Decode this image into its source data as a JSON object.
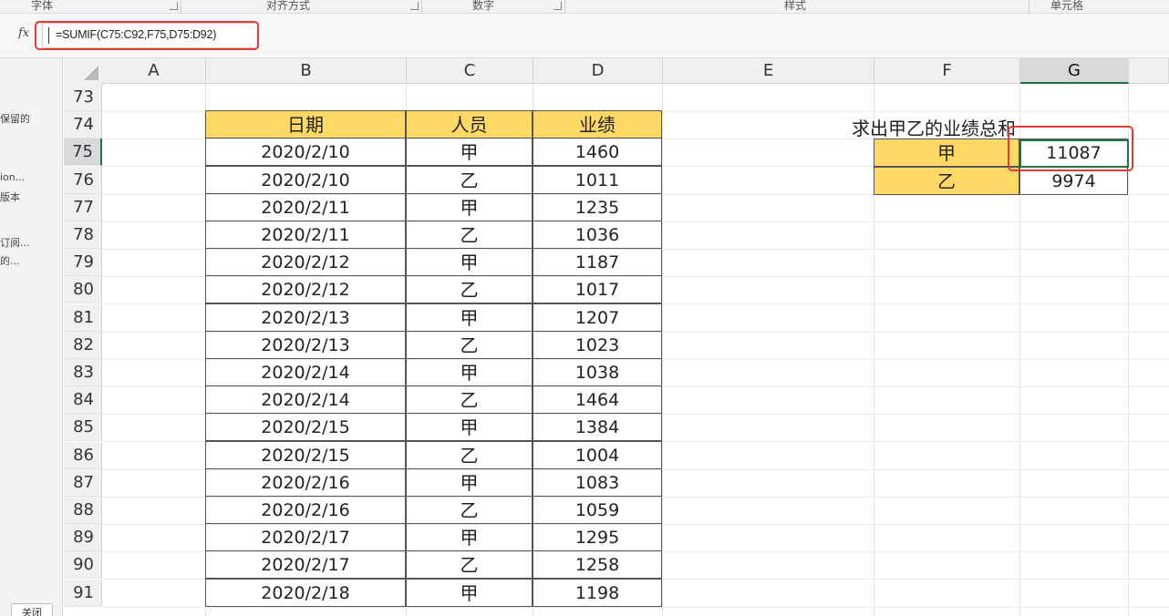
{
  "ribbon_groups": [
    "字体",
    "对齐方式",
    "数字",
    "样式",
    "单元格"
  ],
  "formula_bar": {
    "fx_label": "fx",
    "formula": "=SUMIF(C75:C92,F75,D75:D92)"
  },
  "side_panel": {
    "items": [
      "保留的",
      "ion...",
      "版本",
      "订阅...",
      "的..."
    ],
    "close_label": "关闭"
  },
  "columns": [
    "A",
    "B",
    "C",
    "D",
    "E",
    "F",
    "G"
  ],
  "active_column": "G",
  "row_numbers": [
    "73",
    "74",
    "75",
    "76",
    "77",
    "78",
    "79",
    "80",
    "81",
    "82",
    "83",
    "84",
    "85",
    "86",
    "87",
    "88",
    "89",
    "90",
    "91"
  ],
  "active_row": "75",
  "table": {
    "headers": [
      "日期",
      "人员",
      "业绩"
    ],
    "rows": [
      [
        "2020/2/10",
        "甲",
        "1460"
      ],
      [
        "2020/2/10",
        "乙",
        "1011"
      ],
      [
        "2020/2/11",
        "甲",
        "1235"
      ],
      [
        "2020/2/11",
        "乙",
        "1036"
      ],
      [
        "2020/2/12",
        "甲",
        "1187"
      ],
      [
        "2020/2/12",
        "乙",
        "1017"
      ],
      [
        "2020/2/13",
        "甲",
        "1207"
      ],
      [
        "2020/2/13",
        "乙",
        "1023"
      ],
      [
        "2020/2/14",
        "甲",
        "1038"
      ],
      [
        "2020/2/14",
        "乙",
        "1464"
      ],
      [
        "2020/2/15",
        "甲",
        "1384"
      ],
      [
        "2020/2/15",
        "乙",
        "1004"
      ],
      [
        "2020/2/16",
        "甲",
        "1083"
      ],
      [
        "2020/2/16",
        "乙",
        "1059"
      ],
      [
        "2020/2/17",
        "甲",
        "1295"
      ],
      [
        "2020/2/17",
        "乙",
        "1258"
      ],
      [
        "2020/2/18",
        "甲",
        "1198"
      ]
    ]
  },
  "summary": {
    "note": "求出甲乙的业绩总和",
    "rows": [
      {
        "name": "甲",
        "total": "11087"
      },
      {
        "name": "乙",
        "total": "9974"
      }
    ]
  },
  "colors": {
    "header_fill": "#ffd966",
    "highlight_red": "#e53935",
    "selection_green": "#217346"
  }
}
